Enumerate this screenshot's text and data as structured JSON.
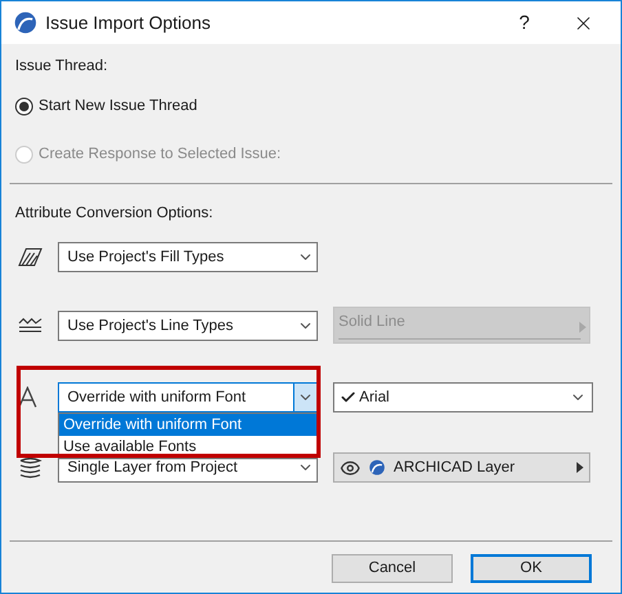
{
  "window": {
    "title": "Issue Import Options",
    "help": "?"
  },
  "issue_thread": {
    "label": "Issue Thread:",
    "options": [
      {
        "label": "Start New Issue Thread",
        "selected": true,
        "disabled": false
      },
      {
        "label": "Create Response to Selected Issue:",
        "selected": false,
        "disabled": true
      }
    ]
  },
  "attribute_conversion": {
    "label": "Attribute Conversion Options:",
    "rows": [
      {
        "kind": "fill",
        "dropdown": "Use Project's Fill Types",
        "open": false,
        "highlighted": false
      },
      {
        "kind": "line",
        "dropdown": "Use Project's Line Types",
        "open": false,
        "highlighted": false,
        "side": {
          "kind": "disabled",
          "value": "Solid Line"
        }
      },
      {
        "kind": "font",
        "dropdown": "Override with uniform Font",
        "open": true,
        "highlighted": true,
        "side": {
          "kind": "checked",
          "value": "Arial"
        },
        "menu": [
          {
            "label": "Override with uniform Font",
            "selected": true
          },
          {
            "label": "Use available Fonts",
            "selected": false
          }
        ]
      },
      {
        "kind": "layer",
        "dropdown": "Single Layer from Project",
        "open": false,
        "highlighted": false,
        "side": {
          "kind": "layer",
          "value": "ARCHICAD Layer"
        }
      }
    ]
  },
  "buttons": [
    {
      "label": "Cancel",
      "default": false
    },
    {
      "label": "OK",
      "default": true
    }
  ]
}
